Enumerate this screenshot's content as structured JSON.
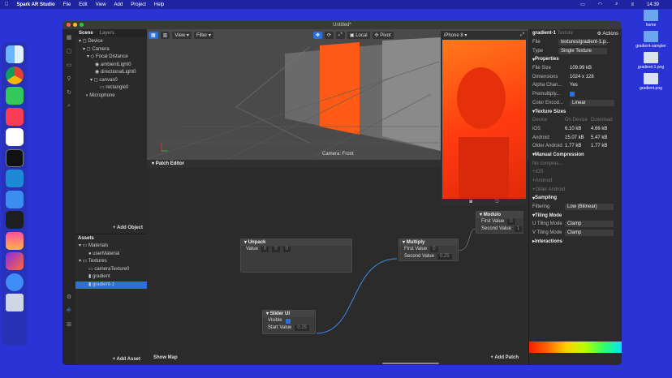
{
  "menubar": {
    "app": "Spark AR Studio",
    "items": [
      "File",
      "Edit",
      "View",
      "Add",
      "Project",
      "Help"
    ],
    "clock": "14:39"
  },
  "desktop": {
    "items": [
      "home",
      "gradient-sampler",
      "gradient-1.png",
      "gradient.png"
    ]
  },
  "window": {
    "title": "Untitled*"
  },
  "scene": {
    "tabs": [
      "Scene",
      "Layers"
    ],
    "tree": [
      "Device",
      "Camera",
      "Focal Distance",
      "ambientLight0",
      "directionalLight0",
      "canvas0",
      "rectangle0",
      "Microphone"
    ],
    "add_object": "+ Add Object"
  },
  "assets": {
    "title": "Assets",
    "tree": [
      "Materials",
      "userMaterial",
      "Textures",
      "cameraTexture0",
      "gradient",
      "gradient-1"
    ],
    "add_asset": "+ Add Asset"
  },
  "viewport": {
    "view": "View",
    "filter": "Filter",
    "local": "Local",
    "pivot": "Pivot",
    "camera_label": "Camera: Front"
  },
  "simulator": {
    "device": "iPhone 8"
  },
  "patch_editor": {
    "title": "Patch Editor",
    "show_map": "Show Map",
    "add_patch": "+ Add Patch",
    "unpack": {
      "title": "Unpack",
      "value": "Value",
      "v1": "0",
      "v2": "0",
      "v3": "0"
    },
    "multiply": {
      "title": "Multiply",
      "first": "First Value",
      "second": "Second Value",
      "first_val": "0",
      "second_val": "0.25"
    },
    "modulo": {
      "title": "Modulo",
      "first": "First Value",
      "second": "Second Value",
      "first_val": "0",
      "second_val": "1"
    },
    "slider": {
      "title": "Slider UI",
      "visible": "Visible",
      "start": "Start Value",
      "start_val": "0.25"
    }
  },
  "inspector": {
    "title": "gradient-1",
    "subtitle": "Texture",
    "actions": "Actions",
    "file_k": "File",
    "file_v": "textures/gradient-1.p...",
    "type_k": "Type",
    "type_v": "Single Texture",
    "properties": "Properties",
    "size_k": "File Size",
    "size_v": "109.99 kB",
    "dim_k": "Dimensions",
    "dim_v": "1024 x 128",
    "alpha_k": "Alpha Chan...",
    "alpha_v": "Yes",
    "premul_k": "Premultiply...",
    "color_k": "Color Encod...",
    "color_v": "Linear",
    "texsizes": "Texture Sizes",
    "ts_device": "Device",
    "ts_ondevice": "On Device",
    "ts_download": "Download",
    "ios": "iOS",
    "ios_a": "6.10 kB",
    "ios_b": "4.66 kB",
    "android": "Android",
    "and_a": "15.07 kB",
    "and_b": "5.47 kB",
    "older": "Older Android",
    "old_a": "1.77 kB",
    "old_b": "1.77 kB",
    "manual": "Manual Compression",
    "nocomp": "No compres...",
    "m_ios": "iOS",
    "m_and": "Android",
    "m_old": "Older Android",
    "sampling": "Sampling",
    "filtering_k": "Filtering",
    "filtering_v": "Low (Bilinear)",
    "tiling": "Tiling Mode",
    "u_k": "U Tiling Mode",
    "u_v": "Clamp",
    "v_k": "V Tiling Mode",
    "v_v": "Clamp",
    "interactions": "Interactions"
  }
}
